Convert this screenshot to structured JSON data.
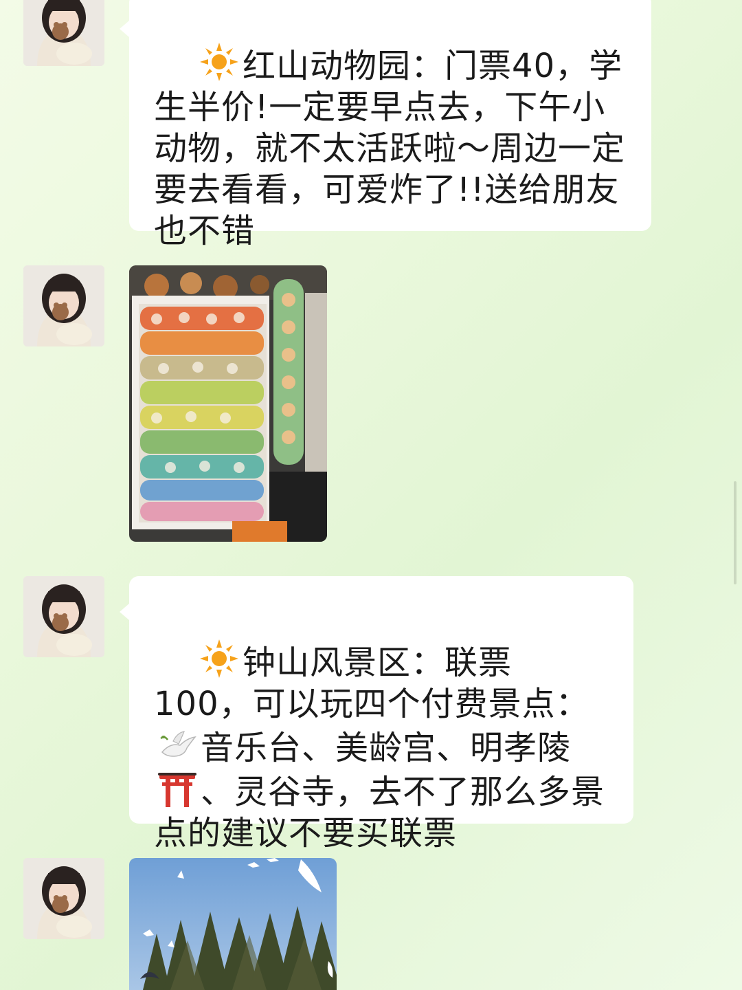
{
  "messages": [
    {
      "type": "text",
      "emoji": "sun-icon",
      "text": "红山动物园：门票40，学生半价!一定要早点去，下午小动物，就不太活跃啦～周边一定要去看看，可爱炸了!!送给朋友也不错"
    },
    {
      "type": "image",
      "description": "plush-toy-wall-photo"
    },
    {
      "type": "text",
      "emoji": "sun-icon",
      "text_part1": "钟山风景区：联票100，可以玩四个付费景点：",
      "text_part2": "音乐台、美龄宫、明孝陵",
      "text_part3": "、灵谷寺，去不了那么多景点的建议不要买联票",
      "inline_icons": [
        "dove-icon",
        "torii-gate-icon"
      ]
    },
    {
      "type": "image",
      "description": "pigeons-trees-photo"
    }
  ],
  "colors": {
    "background": "#eaf8dc",
    "bubble": "#ffffff",
    "text": "#1b1b1b"
  }
}
